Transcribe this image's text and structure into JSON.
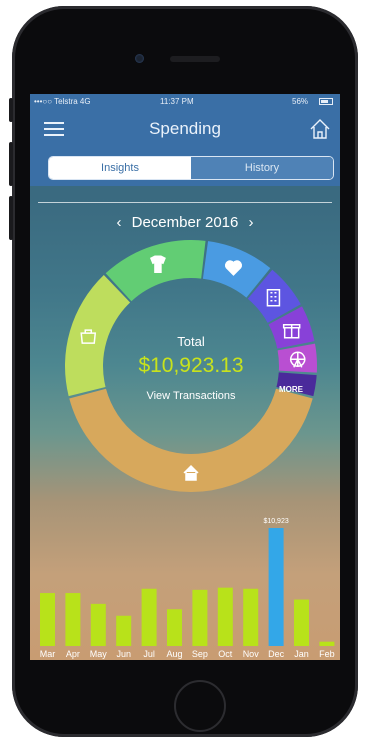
{
  "status": {
    "carrier": "•••○○ Telstra  4G",
    "time": "11:37 PM",
    "battery": "56%"
  },
  "header": {
    "title": "Spending"
  },
  "tabs": [
    {
      "label": "Insights",
      "active": true
    },
    {
      "label": "History",
      "active": false
    }
  ],
  "period": {
    "label": "December 2016",
    "prev": "‹",
    "next": "›"
  },
  "summary": {
    "total_label": "Total",
    "total_amount": "$10,923.13",
    "view_transactions": "View Transactions",
    "more_label": "MORE"
  },
  "categories": [
    {
      "icon": "house-icon",
      "color": "#d7a85c",
      "share": 0.42
    },
    {
      "icon": "shopping-icon",
      "color": "#bedd5d",
      "share": 0.17
    },
    {
      "icon": "clothing-icon",
      "color": "#62cd74",
      "share": 0.14
    },
    {
      "icon": "health-icon",
      "color": "#4a9be2",
      "share": 0.09
    },
    {
      "icon": "building-icon",
      "color": "#5d55e1",
      "share": 0.06
    },
    {
      "icon": "gift-icon",
      "color": "#8841d8",
      "share": 0.05
    },
    {
      "icon": "ferris-wheel-icon",
      "color": "#b94fd2",
      "share": 0.04
    },
    {
      "icon": "more-icon",
      "color": "#4a2a9b",
      "share": 0.03
    }
  ],
  "chart_data": {
    "type": "bar",
    "categories": [
      "Mar",
      "Apr",
      "May",
      "Jun",
      "Jul",
      "Aug",
      "Sep",
      "Oct",
      "Nov",
      "Dec",
      "Jan",
      "Feb"
    ],
    "values": [
      4900,
      4900,
      3900,
      2800,
      5300,
      3400,
      5200,
      5400,
      5300,
      10923,
      4300,
      400
    ],
    "highlight_index": 9,
    "highlight_label": "$10,923",
    "colors": {
      "normal": "#b8e21a",
      "highlight": "#33a7e8"
    }
  }
}
